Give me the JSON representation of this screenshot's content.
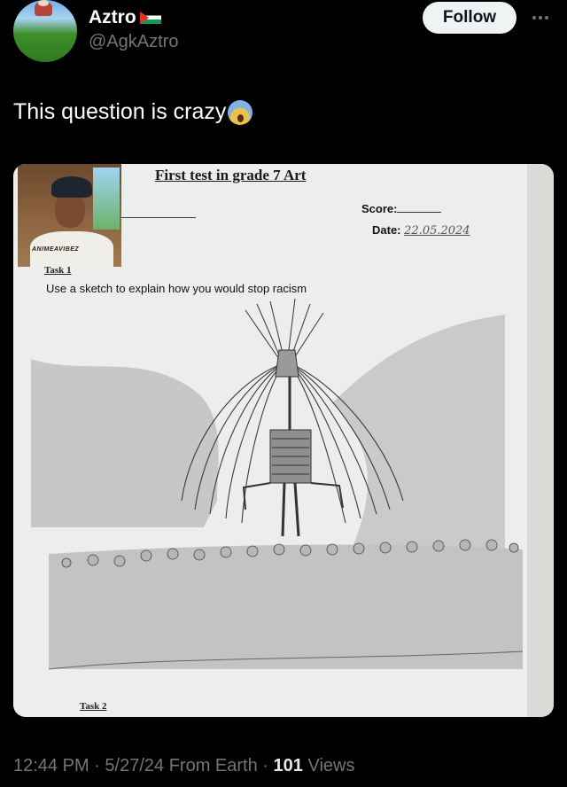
{
  "author": {
    "display_name": "Aztro",
    "handle": "@AgkAztro",
    "flag_icon": "palestine-flag-icon"
  },
  "follow_label": "Follow",
  "more_icon": "more-horizontal-icon",
  "tweet_text": "This question is crazy",
  "tweet_emoji": "face-screaming-in-fear-emoji",
  "image": {
    "test_title": "First test in grade 7 Art",
    "score_label": "Score:",
    "date_label": "Date:",
    "date_value": "22.05.2024",
    "task1_label": "Task 1",
    "task_instruction": "Use a sketch to explain how you would stop racism",
    "task2_label": "Task 2",
    "inset_watermark": "ANIMEAVIBEZ"
  },
  "meta": {
    "time": "12:44 PM",
    "date": "5/27/24",
    "source": "From Earth",
    "views_count": "101",
    "views_label": "Views",
    "sep": "·"
  },
  "colors": {
    "background": "#000000",
    "text_primary": "#e7e9ea",
    "text_secondary": "#71767b",
    "follow_button_bg": "#eff3f4"
  }
}
